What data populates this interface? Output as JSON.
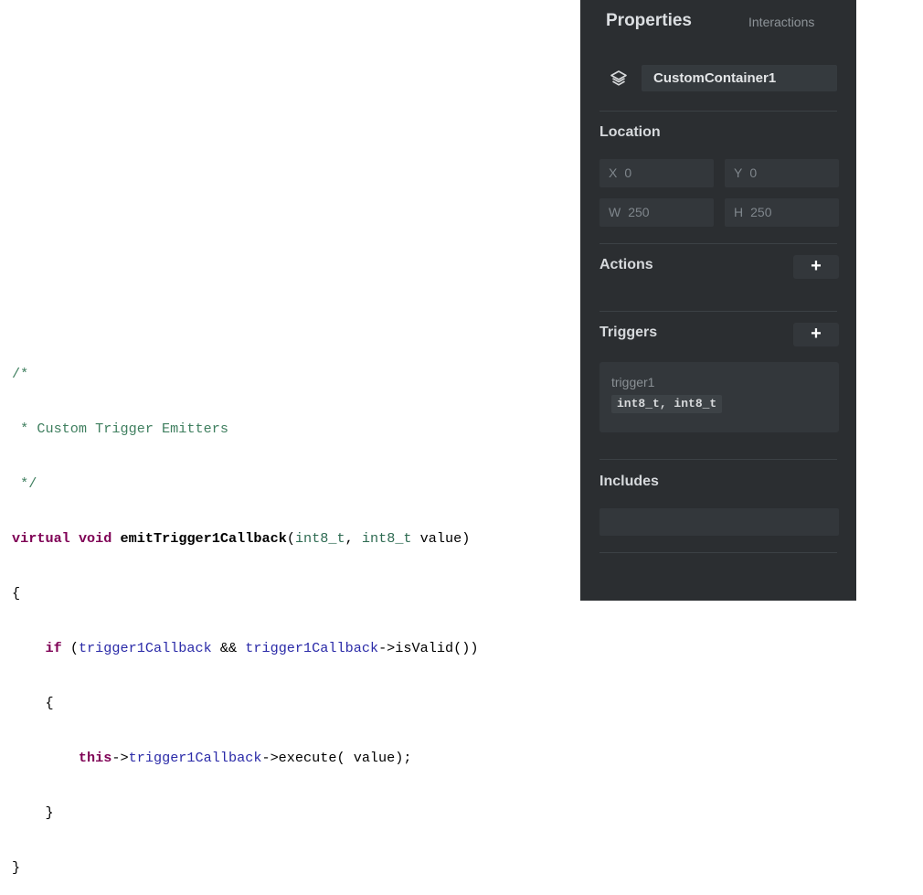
{
  "code": {
    "comment_open": "/*",
    "comment_title": " * Custom Trigger Emitters",
    "comment_close": " */",
    "kw_virtual": "virtual",
    "kw_void": "void",
    "fn_name": "emitTrigger1Callback",
    "paren_open": "(",
    "type1": "int8_t",
    "comma": ", ",
    "type2": "int8_t",
    "param_rest": " value)",
    "brace_open": "{",
    "kw_if": "if",
    "if_paren": " (",
    "var1": "trigger1Callback",
    "and_op": " && ",
    "var2": "trigger1Callback",
    "is_valid": "->isValid())",
    "inner_brace_open": "{",
    "kw_this": "this",
    "arrow": "->",
    "var3": "trigger1Callback",
    "execute": "->execute( value);",
    "inner_brace_close": "}",
    "brace_close": "}"
  },
  "panel": {
    "tab_properties": "Properties",
    "tab_interactions": "Interactions",
    "name_value": "CustomContainer1",
    "location_title": "Location",
    "x_label": "X",
    "x_value": "0",
    "y_label": "Y",
    "y_value": "0",
    "w_label": "W",
    "w_value": "250",
    "h_label": "H",
    "h_value": "250",
    "actions_title": "Actions",
    "triggers_title": "Triggers",
    "add_symbol": "+",
    "trigger_name": "trigger1",
    "trigger_signature": "int8_t, int8_t",
    "includes_title": "Includes",
    "includes_value": ""
  },
  "colors": {
    "panel_bg": "#2b2e31",
    "field_bg": "#33373b",
    "comment": "#3f7f5f",
    "keyword": "#7f0055",
    "variable": "#2a2aa8"
  },
  "icons": {
    "layers": "layers-icon",
    "add": "plus-icon"
  }
}
